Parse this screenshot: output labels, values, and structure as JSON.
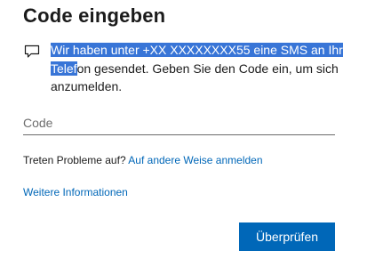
{
  "header": {
    "title": "Code eingeben"
  },
  "message": {
    "icon": "chat-bubble-icon",
    "highlighted_text": "Wir haben unter +XX XXXXXXXX55 eine SMS an Ihr Telef",
    "rest_text": "on gesendet. Geben Sie den Code ein, um sich anzumelden."
  },
  "code_field": {
    "placeholder": "Code",
    "value": ""
  },
  "help": {
    "prompt": "Treten Probleme auf?",
    "alt_link": "Auf andere Weise anmelden",
    "more_info": "Weitere Informationen"
  },
  "actions": {
    "verify_label": "Überprüfen"
  },
  "colors": {
    "accent": "#0067b8",
    "selection": "#3875d7"
  }
}
